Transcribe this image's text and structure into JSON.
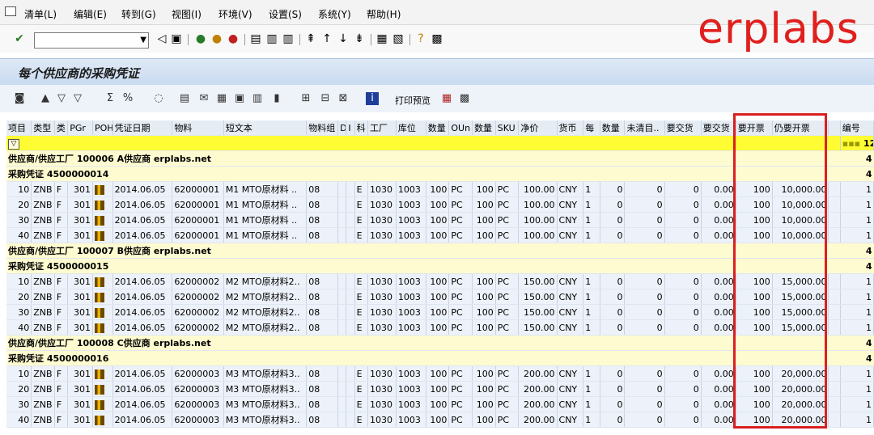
{
  "menu": [
    "清单(L)",
    "编辑(E)",
    "转到(G)",
    "视图(I)",
    "环境(V)",
    "设置(S)",
    "系统(Y)",
    "帮助(H)"
  ],
  "brand": "erplabs",
  "page_title": "每个供应商的采购凭证",
  "toolbar2_text": "打印预览",
  "columns": [
    "项目",
    "类型",
    "类",
    "PGr",
    "POH",
    "凭证日期",
    "物料",
    "短文本",
    "物料组",
    "D",
    "I",
    "科",
    "工厂",
    "库位",
    "数量",
    "OUn",
    "数量",
    "SKU",
    "净价",
    "货币",
    "每",
    "数量",
    "未清目..",
    "要交货",
    "要交货",
    "要开票",
    "仍要开票",
    "",
    "编号"
  ],
  "filter_count": "12",
  "groups": [
    {
      "vendor": "供应商/供应工厂 100006     A供应商 erplabs.net",
      "vendor_count": "4",
      "doc": "采购凭证 4500000014",
      "doc_count": "4",
      "rows": [
        [
          "10",
          "ZNB",
          "F",
          "301",
          "2014.06.05",
          "62000001",
          "M1 MTO原材料 ..",
          "08",
          "E",
          "1030",
          "1003",
          "100",
          "PC",
          "100",
          "PC",
          "100.00",
          "CNY",
          "1",
          "0",
          "0",
          "0",
          "0.00",
          "100",
          "10,000.00",
          "1"
        ],
        [
          "20",
          "ZNB",
          "F",
          "301",
          "2014.06.05",
          "62000001",
          "M1 MTO原材料 ..",
          "08",
          "E",
          "1030",
          "1003",
          "100",
          "PC",
          "100",
          "PC",
          "100.00",
          "CNY",
          "1",
          "0",
          "0",
          "0",
          "0.00",
          "100",
          "10,000.00",
          "1"
        ],
        [
          "30",
          "ZNB",
          "F",
          "301",
          "2014.06.05",
          "62000001",
          "M1 MTO原材料 ..",
          "08",
          "E",
          "1030",
          "1003",
          "100",
          "PC",
          "100",
          "PC",
          "100.00",
          "CNY",
          "1",
          "0",
          "0",
          "0",
          "0.00",
          "100",
          "10,000.00",
          "1"
        ],
        [
          "40",
          "ZNB",
          "F",
          "301",
          "2014.06.05",
          "62000001",
          "M1 MTO原材料 ..",
          "08",
          "E",
          "1030",
          "1003",
          "100",
          "PC",
          "100",
          "PC",
          "100.00",
          "CNY",
          "1",
          "0",
          "0",
          "0",
          "0.00",
          "100",
          "10,000.00",
          "1"
        ]
      ]
    },
    {
      "vendor": "供应商/供应工厂 100007     B供应商 erplabs.net",
      "vendor_count": "4",
      "doc": "采购凭证 4500000015",
      "doc_count": "4",
      "rows": [
        [
          "10",
          "ZNB",
          "F",
          "301",
          "2014.06.05",
          "62000002",
          "M2 MTO原材料2..",
          "08",
          "E",
          "1030",
          "1003",
          "100",
          "PC",
          "100",
          "PC",
          "150.00",
          "CNY",
          "1",
          "0",
          "0",
          "0",
          "0.00",
          "100",
          "15,000.00",
          "1"
        ],
        [
          "20",
          "ZNB",
          "F",
          "301",
          "2014.06.05",
          "62000002",
          "M2 MTO原材料2..",
          "08",
          "E",
          "1030",
          "1003",
          "100",
          "PC",
          "100",
          "PC",
          "150.00",
          "CNY",
          "1",
          "0",
          "0",
          "0",
          "0.00",
          "100",
          "15,000.00",
          "1"
        ],
        [
          "30",
          "ZNB",
          "F",
          "301",
          "2014.06.05",
          "62000002",
          "M2 MTO原材料2..",
          "08",
          "E",
          "1030",
          "1003",
          "100",
          "PC",
          "100",
          "PC",
          "150.00",
          "CNY",
          "1",
          "0",
          "0",
          "0",
          "0.00",
          "100",
          "15,000.00",
          "1"
        ],
        [
          "40",
          "ZNB",
          "F",
          "301",
          "2014.06.05",
          "62000002",
          "M2 MTO原材料2..",
          "08",
          "E",
          "1030",
          "1003",
          "100",
          "PC",
          "100",
          "PC",
          "150.00",
          "CNY",
          "1",
          "0",
          "0",
          "0",
          "0.00",
          "100",
          "15,000.00",
          "1"
        ]
      ]
    },
    {
      "vendor": "供应商/供应工厂 100008     C供应商 erplabs.net",
      "vendor_count": "4",
      "doc": "采购凭证 4500000016",
      "doc_count": "4",
      "rows": [
        [
          "10",
          "ZNB",
          "F",
          "301",
          "2014.06.05",
          "62000003",
          "M3 MTO原材料3..",
          "08",
          "E",
          "1030",
          "1003",
          "100",
          "PC",
          "100",
          "PC",
          "200.00",
          "CNY",
          "1",
          "0",
          "0",
          "0",
          "0.00",
          "100",
          "20,000.00",
          "1"
        ],
        [
          "20",
          "ZNB",
          "F",
          "301",
          "2014.06.05",
          "62000003",
          "M3 MTO原材料3..",
          "08",
          "E",
          "1030",
          "1003",
          "100",
          "PC",
          "100",
          "PC",
          "200.00",
          "CNY",
          "1",
          "0",
          "0",
          "0",
          "0.00",
          "100",
          "20,000.00",
          "1"
        ],
        [
          "30",
          "ZNB",
          "F",
          "301",
          "2014.06.05",
          "62000003",
          "M3 MTO原材料3..",
          "08",
          "E",
          "1030",
          "1003",
          "100",
          "PC",
          "100",
          "PC",
          "200.00",
          "CNY",
          "1",
          "0",
          "0",
          "0",
          "0.00",
          "100",
          "20,000.00",
          "1"
        ],
        [
          "40",
          "ZNB",
          "F",
          "301",
          "2014.06.05",
          "62000003",
          "M3 MTO原材料3..",
          "08",
          "E",
          "1030",
          "1003",
          "100",
          "PC",
          "100",
          "PC",
          "200.00",
          "CNY",
          "1",
          "0",
          "0",
          "0",
          "0.00",
          "100",
          "20,000.00",
          "1"
        ]
      ]
    }
  ],
  "colors": {
    "accent": "#e0201e",
    "group_bg": "#fffbd0",
    "filter_bg": "#fffc33",
    "row_bg": "#edf2fa"
  }
}
